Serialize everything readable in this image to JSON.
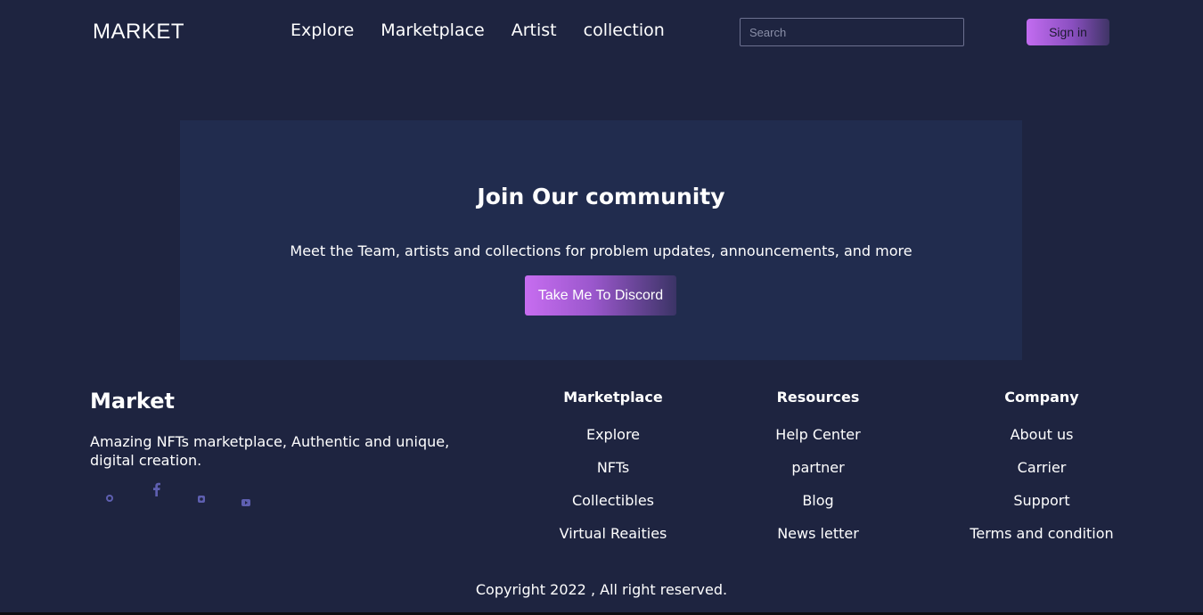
{
  "header": {
    "logo": "MARKET",
    "nav": [
      "Explore",
      "Marketplace",
      "Artist",
      "collection"
    ],
    "search_placeholder": "Search",
    "signin_label": "Sign in"
  },
  "community": {
    "title": "Join Our community",
    "text": "Meet the Team, artists and collections for problem updates, announcements, and more",
    "button_label": "Take Me To Discord"
  },
  "footer": {
    "brand": "Market",
    "description": "Amazing NFTs marketplace, Authentic and unique, digital creation.",
    "socials": [
      "globe-icon",
      "facebook-icon",
      "instagram-icon",
      "youtube-icon"
    ],
    "columns": [
      {
        "title": "Marketplace",
        "links": [
          "Explore",
          "NFTs",
          "Collectibles",
          "Virtual Reaities"
        ]
      },
      {
        "title": "Resources",
        "links": [
          "Help Center",
          "partner",
          "Blog",
          "News letter"
        ]
      },
      {
        "title": "Company",
        "links": [
          "About us",
          "Carrier",
          "Support",
          "Terms and condition"
        ]
      }
    ],
    "copyright": "Copyright 2022 , All right reserved."
  },
  "colors": {
    "background": "#1e2440",
    "panel": "#212c4e",
    "accent_start": "#c76df0",
    "accent_end": "#3b3466",
    "social_icon": "#5e5fb0"
  }
}
